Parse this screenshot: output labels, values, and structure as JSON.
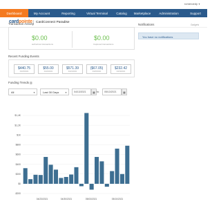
{
  "user": {
    "name": "romeroedy"
  },
  "nav": {
    "items": [
      {
        "label": "Dashboard",
        "active": true
      },
      {
        "label": "My Account"
      },
      {
        "label": "Reporting"
      },
      {
        "label": "Virtual Terminal"
      },
      {
        "label": "Catalog"
      },
      {
        "label": "Marketplace"
      },
      {
        "label": "Administration"
      },
      {
        "label": "Support"
      }
    ]
  },
  "brand": {
    "logo_main": "card",
    "logo_accent": "pointe",
    "merchant": "CardConnect Paradise"
  },
  "transaction_activity": {
    "label": "Transaction Activity",
    "authorized_amount": "$0.00",
    "authorized_label": "authorized transactions",
    "captured_amount": "$0.00",
    "captured_label": "Captured transactions"
  },
  "notifications": {
    "label": "Notifications",
    "gadgets": "Gadgets",
    "message": "You have no notifications"
  },
  "recent_funding": {
    "label": "Recent Funding Events",
    "events": [
      {
        "amount": "$440.75",
        "date": "04/23/2021"
      },
      {
        "amount": "$55.00",
        "date": "04/22/2021"
      },
      {
        "amount": "$571.39",
        "date": "04/21/2021"
      },
      {
        "amount": "($67.05)",
        "date": "04/20/2021"
      },
      {
        "amount": "$232.42",
        "date": "04/19/2021"
      }
    ]
  },
  "funding_trends": {
    "label": "Funding Trends",
    "filter_all": "All",
    "range": "Last 30 Days",
    "date_from": "04/13/2021",
    "date_to": "05/13/2021",
    "to_label": "to"
  },
  "chart_data": {
    "type": "bar",
    "title": "",
    "ylabel": "",
    "xlabel": "",
    "ylim": [
      -200,
      1400
    ],
    "yticks": [
      "$1,4K",
      "$1,2K",
      "$1K",
      "$800",
      "$600",
      "$400",
      "$200",
      "$0",
      "-$200"
    ],
    "xticks": [
      "04/23/2021",
      "04/30/2021",
      "05/03/2021",
      "05/10/2021"
    ],
    "color": "#3d6e91",
    "values": [
      320,
      95,
      185,
      180,
      550,
      390,
      290,
      120,
      140,
      190,
      340,
      -50,
      1450,
      -120,
      550,
      460,
      -60,
      260,
      720,
      200,
      780
    ]
  }
}
